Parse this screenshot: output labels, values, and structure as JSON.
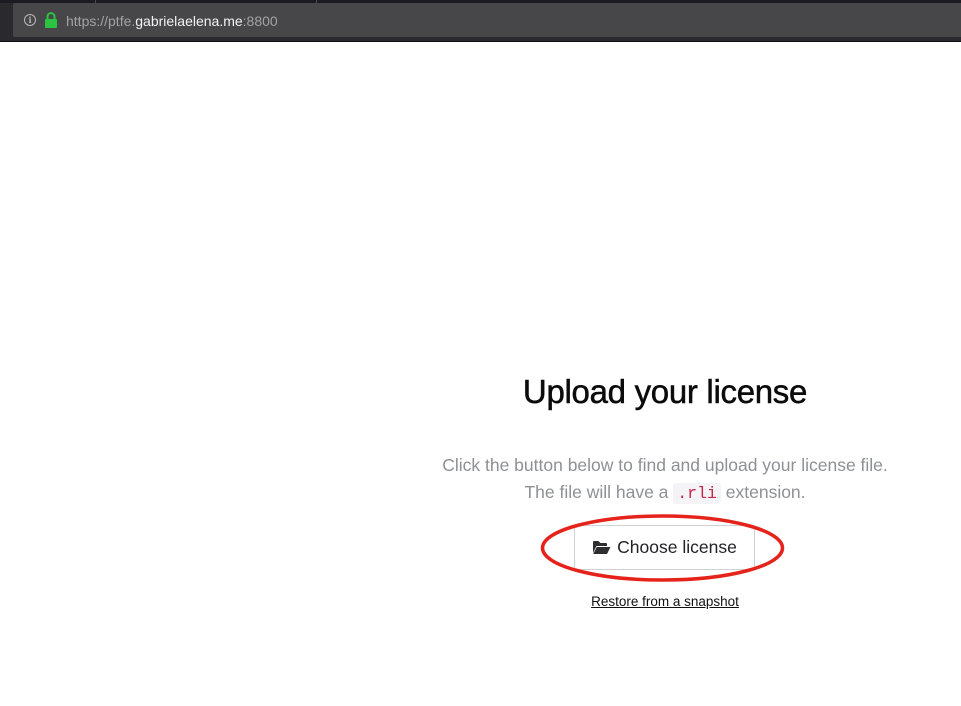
{
  "browser": {
    "url_scheme": "https://ptfe.",
    "url_host": "gabrielaelena.me",
    "url_port": ":8800",
    "info_icon": "info-icon",
    "lock_icon": "lock-icon",
    "lock_color": "#2ac440"
  },
  "main": {
    "title": "Upload your license",
    "description_line1": "Click the button below to find and upload your license file.",
    "description_line2_before": "The file will have a ",
    "description_code": ".rli",
    "description_line2_after": " extension.",
    "choose_button_label": "Choose license",
    "choose_button_icon": "folder-open-icon",
    "restore_link": "Restore from a snapshot"
  },
  "annotation": {
    "highlight_color": "#e5231b"
  }
}
